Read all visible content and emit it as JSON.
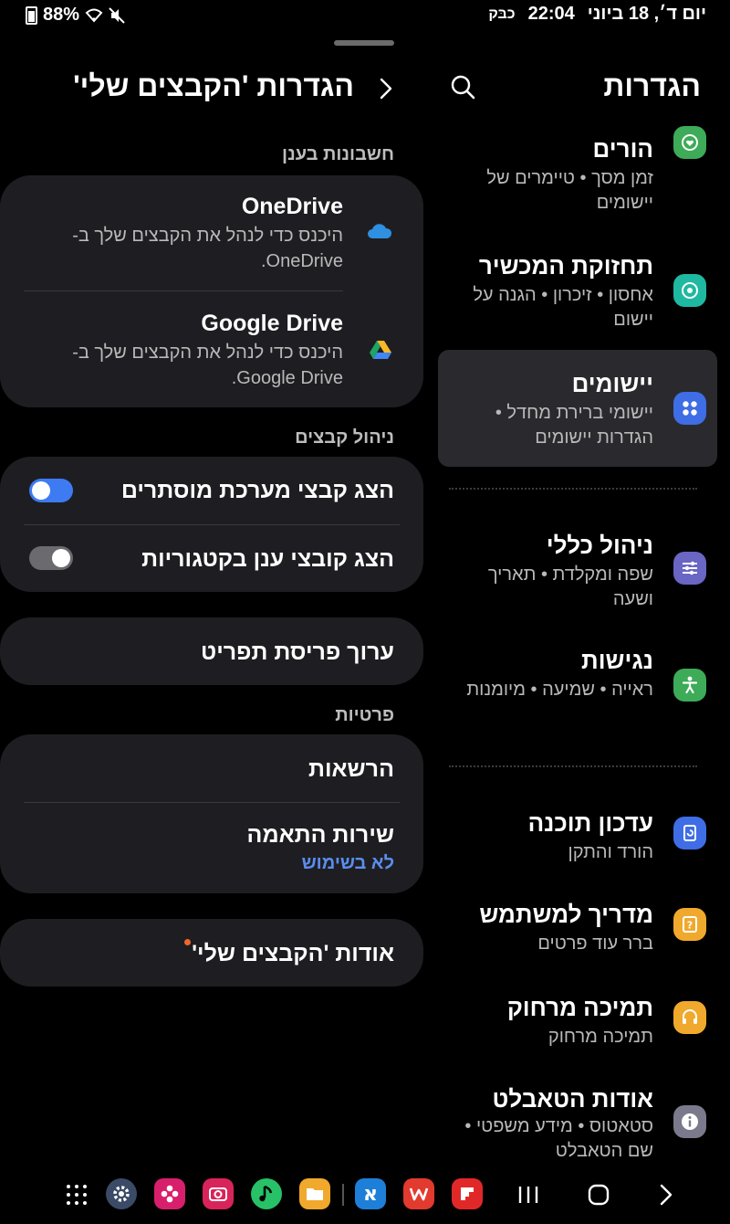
{
  "status_bar": {
    "battery": "88%",
    "time": "22:04",
    "date": "יום ד׳, 18 ביוני",
    "carrier": "כבּק"
  },
  "settings_list": {
    "title": "הגדרות",
    "items": [
      {
        "title": "הורים",
        "subtitle": "זמן מסך • טיימרים של יישומים",
        "icon": "heart-shield-icon",
        "color": "#3dab57"
      },
      {
        "title": "תחזוקת המכשיר",
        "subtitle": "אחסון • זיכרון • הגנה על יישום",
        "icon": "device-care-icon",
        "color": "#1fb8a0"
      },
      {
        "title": "יישומים",
        "subtitle": "יישומי ברירת מחדל • הגדרות יישומים",
        "icon": "apps-grid-icon",
        "color": "#3f6de5"
      },
      {
        "title": "ניהול כללי",
        "subtitle": "שפה ומקלדת • תאריך ושעה",
        "icon": "sliders-icon",
        "color": "#6a66c4"
      },
      {
        "title": "נגישות",
        "subtitle": "ראייה • שמיעה • מיומנות",
        "icon": "accessibility-icon",
        "color": "#3dab57"
      },
      {
        "title": "עדכון תוכנה",
        "subtitle": "הורד והתקן",
        "icon": "software-update-icon",
        "color": "#3f6de5"
      },
      {
        "title": "מדריך למשתמש",
        "subtitle": "ברר עוד פרטים",
        "icon": "user-manual-icon",
        "color": "#f0a92c"
      },
      {
        "title": "תמיכה מרחוק",
        "subtitle": "תמיכה מרחוק",
        "icon": "headset-icon",
        "color": "#f0a92c"
      },
      {
        "title": "אודות הטאבלט",
        "subtitle": "סטאטוס • מידע משפטי • שם הטאבלט",
        "icon": "info-icon",
        "color": "#7a7a8c"
      }
    ]
  },
  "my_files_settings": {
    "title": "הגדרות 'הקבצים שלי'",
    "cloud_section_label": "חשבונות בענן",
    "cloud_accounts": [
      {
        "name": "OneDrive",
        "desc": "היכנס כדי לנהל את הקבצים שלך ב-OneDrive.",
        "icon": "onedrive-icon"
      },
      {
        "name": "Google Drive",
        "desc": "היכנס כדי לנהל את הקבצים שלך ב-Google Drive.",
        "icon": "google-drive-icon"
      }
    ],
    "file_mgmt_label": "ניהול קבצים",
    "show_hidden_label": "הצג קבצי מערכת מוסתרים",
    "show_hidden_on": true,
    "show_cloud_label": "הצג קובצי ענן בקטגוריות",
    "show_cloud_on": false,
    "edit_menu_label": "ערוך פריסת תפריט",
    "privacy_label": "פרטיות",
    "permissions_label": "הרשאות",
    "sync_label": "שירות התאמה",
    "sync_value": "לא בשימוש",
    "about_label": "אודות 'הקבצים שלי'"
  },
  "nav_bar": {
    "apps": [
      "apps-drawer-icon",
      "settings-icon",
      "gallery-icon",
      "camera-icon",
      "music-icon",
      "my-files-icon",
      "alef-dictionary-icon",
      "wps-office-icon",
      "flipboard-icon"
    ],
    "buttons": [
      "recents-button",
      "home-button",
      "back-button"
    ]
  }
}
